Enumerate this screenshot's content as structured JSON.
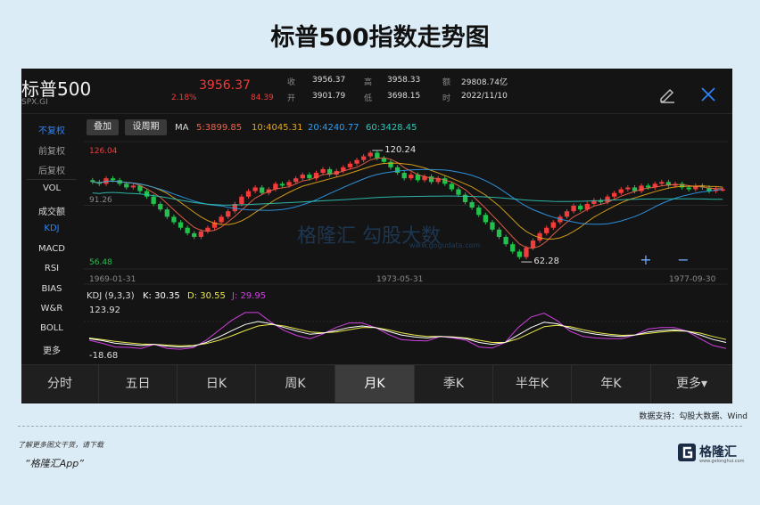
{
  "page": {
    "title": "标普500指数走势图",
    "source": "数据支持：勾股大数据、Wind",
    "footer_line1": "了解更多图文干货，请下载",
    "footer_line2": "“格隆汇App”",
    "logo_text": "格隆汇",
    "logo_sub": "www.gelonghui.com"
  },
  "header": {
    "name": "标普500",
    "code": "SPX.GI",
    "price": "3956.37",
    "pct": "2.18%",
    "change": "84.39",
    "quote": [
      {
        "label": "收",
        "value": "3956.37"
      },
      {
        "label": "高",
        "value": "3958.33"
      },
      {
        "label": "额",
        "value": "29808.74亿"
      },
      {
        "label": "开",
        "value": "3901.79"
      },
      {
        "label": "低",
        "value": "3698.15"
      },
      {
        "label": "时",
        "value": "2022/11/10"
      }
    ],
    "edit_icon": "pencil-icon",
    "close_icon": "close-icon"
  },
  "sidebar": {
    "items": [
      "不复权",
      "前复权",
      "后复权",
      "VOL",
      "成交额",
      "KDJ",
      "MACD",
      "RSI",
      "BIAS",
      "W&R",
      "BOLL",
      "更多"
    ],
    "active": "KDJ"
  },
  "toolbar": {
    "overlay": "叠加",
    "period": "设周期",
    "ma_label": "MA",
    "ma": [
      {
        "text": "5:3899.85",
        "color": "#f0644a"
      },
      {
        "text": "10:4045.31",
        "color": "#e6a817"
      },
      {
        "text": "20:4240.77",
        "color": "#2f9df0"
      },
      {
        "text": "60:3428.45",
        "color": "#2fc7b8"
      }
    ]
  },
  "main_chart": {
    "y_top": "126.04",
    "y_mid": "91.26",
    "y_bottom": "56.48",
    "peak": "120.24",
    "trough": "62.28",
    "dates": [
      "1969-01-31",
      "1973-05-31",
      "1977-09-30"
    ],
    "zoom_in": "+",
    "zoom_out": "−",
    "watermark": "格隆汇  勾股大数",
    "watermark_sub": "www.gogudata.com"
  },
  "kdj": {
    "title": "KDJ (9,3,3)",
    "k": "K: 30.35",
    "d": "D: 30.55",
    "j": "J: 29.95",
    "y_top": "123.92",
    "y_bottom": "-18.68"
  },
  "tabs": {
    "items": [
      "分时",
      "五日",
      "日K",
      "周K",
      "月K",
      "季K",
      "半年K",
      "年K",
      "更多▾"
    ],
    "active": "月K"
  },
  "colors": {
    "up": "#f23b3b",
    "down": "#22c04c",
    "k": "#ffffff",
    "d": "#e8e84a",
    "j": "#d040e0"
  },
  "chart_data": {
    "type": "candlestick",
    "title": "",
    "x": [
      "1969-01-31",
      "1973-05-31",
      "1977-09-30"
    ],
    "ylim": [
      56.48,
      126.04
    ],
    "candles_close": [
      104,
      103,
      106,
      105,
      103,
      101,
      102,
      99,
      96,
      92,
      89,
      85,
      82,
      79,
      76,
      74,
      77,
      79,
      82,
      85,
      88,
      92,
      96,
      99,
      101,
      98,
      100,
      103,
      102,
      104,
      106,
      108,
      106,
      109,
      111,
      108,
      110,
      112,
      114,
      116,
      118,
      120,
      117,
      115,
      112,
      109,
      106,
      108,
      105,
      107,
      104,
      106,
      103,
      100,
      97,
      93,
      90,
      86,
      82,
      78,
      74,
      70,
      66,
      63,
      68,
      72,
      76,
      79,
      82,
      85,
      88,
      91,
      89,
      92,
      94,
      93,
      96,
      98,
      100,
      101,
      99,
      102,
      101,
      103,
      104,
      102,
      103,
      101,
      100,
      102,
      101,
      99,
      100,
      100
    ],
    "ma_series": [
      "5",
      "10",
      "20",
      "60"
    ],
    "peak": 120.24,
    "trough": 62.28,
    "kdj": {
      "ylim": [
        -18.68,
        123.92
      ],
      "k": [
        40,
        35,
        28,
        25,
        22,
        25,
        20,
        18,
        20,
        30,
        45,
        62,
        78,
        86,
        80,
        70,
        60,
        52,
        55,
        62,
        70,
        74,
        70,
        60,
        50,
        45,
        42,
        46,
        44,
        40,
        30,
        25,
        30,
        50,
        70,
        84,
        80,
        68,
        58,
        52,
        48,
        46,
        50,
        58,
        62,
        64,
        60,
        50,
        38,
        30
      ],
      "d": [
        42,
        38,
        33,
        29,
        26,
        25,
        23,
        21,
        22,
        27,
        36,
        48,
        62,
        74,
        78,
        74,
        66,
        58,
        56,
        58,
        64,
        70,
        70,
        64,
        56,
        50,
        46,
        46,
        45,
        42,
        36,
        30,
        30,
        40,
        56,
        72,
        76,
        72,
        64,
        57,
        52,
        49,
        50,
        54,
        58,
        61,
        60,
        55,
        46,
        38
      ],
      "j": [
        36,
        28,
        18,
        17,
        14,
        25,
        14,
        12,
        16,
        36,
        63,
        90,
        110,
        110,
        84,
        62,
        48,
        40,
        53,
        70,
        82,
        82,
        70,
        52,
        38,
        35,
        34,
        46,
        42,
        36,
        18,
        15,
        30,
        70,
        98,
        108,
        88,
        60,
        46,
        42,
        40,
        40,
        50,
        66,
        70,
        70,
        60,
        40,
        22,
        14
      ]
    }
  }
}
